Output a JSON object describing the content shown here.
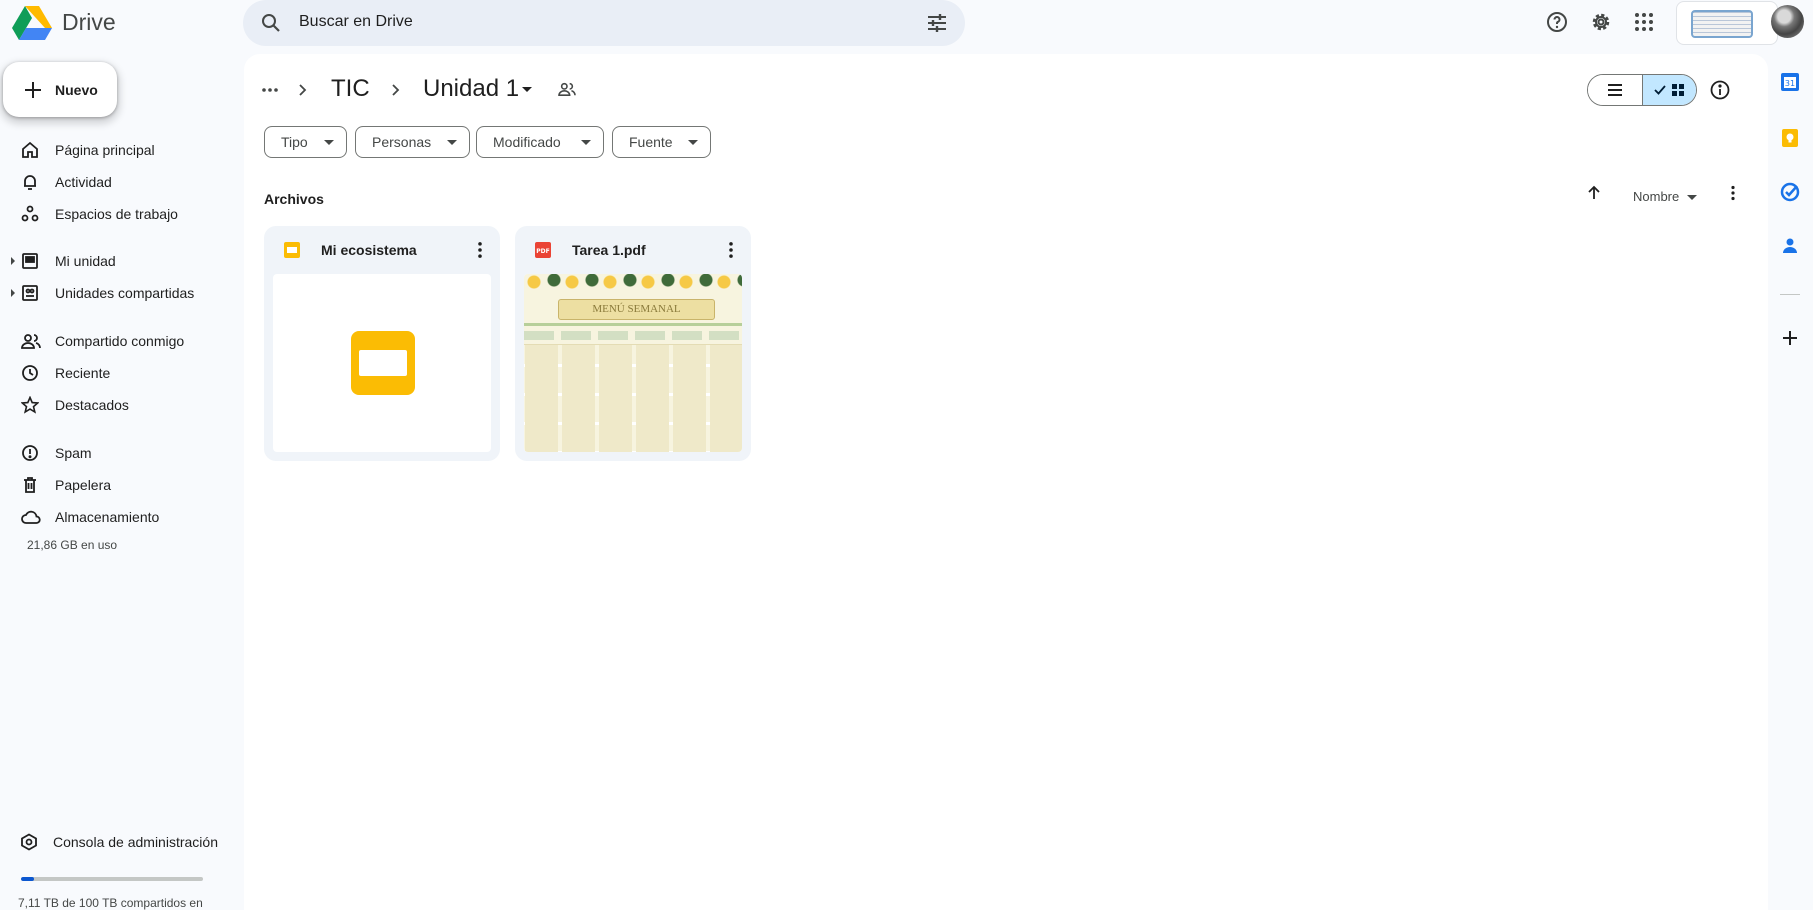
{
  "app": {
    "name": "Drive"
  },
  "search": {
    "placeholder": "Buscar en Drive"
  },
  "sidebar": {
    "new_label": "Nuevo",
    "items": [
      {
        "label": "Página principal",
        "icon": "home-icon"
      },
      {
        "label": "Actividad",
        "icon": "bell-icon"
      },
      {
        "label": "Espacios de trabajo",
        "icon": "workspaces-icon"
      },
      {
        "label": "Mi unidad",
        "icon": "my-drive-icon"
      },
      {
        "label": "Unidades compartidas",
        "icon": "shared-drives-icon"
      },
      {
        "label": "Compartido conmigo",
        "icon": "people-icon"
      },
      {
        "label": "Reciente",
        "icon": "clock-icon"
      },
      {
        "label": "Destacados",
        "icon": "star-icon"
      },
      {
        "label": "Spam",
        "icon": "spam-icon"
      },
      {
        "label": "Papelera",
        "icon": "trash-icon"
      },
      {
        "label": "Almacenamiento",
        "icon": "cloud-icon"
      }
    ],
    "storage_used": "21,86 GB en uso",
    "admin_label": "Consola de administración",
    "quota_text": "7,11 TB de 100 TB compartidos en",
    "quota_fraction": 0.0711
  },
  "breadcrumb": {
    "parent": "TIC",
    "current": "Unidad 1"
  },
  "filters": [
    "Tipo",
    "Personas",
    "Modificado",
    "Fuente"
  ],
  "files_section": {
    "title": "Archivos",
    "sort_label": "Nombre"
  },
  "files": [
    {
      "name": "Mi ecosistema",
      "type": "slides"
    },
    {
      "name": "Tarea 1.pdf",
      "type": "pdf",
      "thumb_title": "MENÚ SEMANAL"
    }
  ],
  "colors": {
    "accent": "#0b57d0",
    "slides": "#fbbc04",
    "pdf": "#ea4335",
    "selected": "#c2e7ff"
  }
}
